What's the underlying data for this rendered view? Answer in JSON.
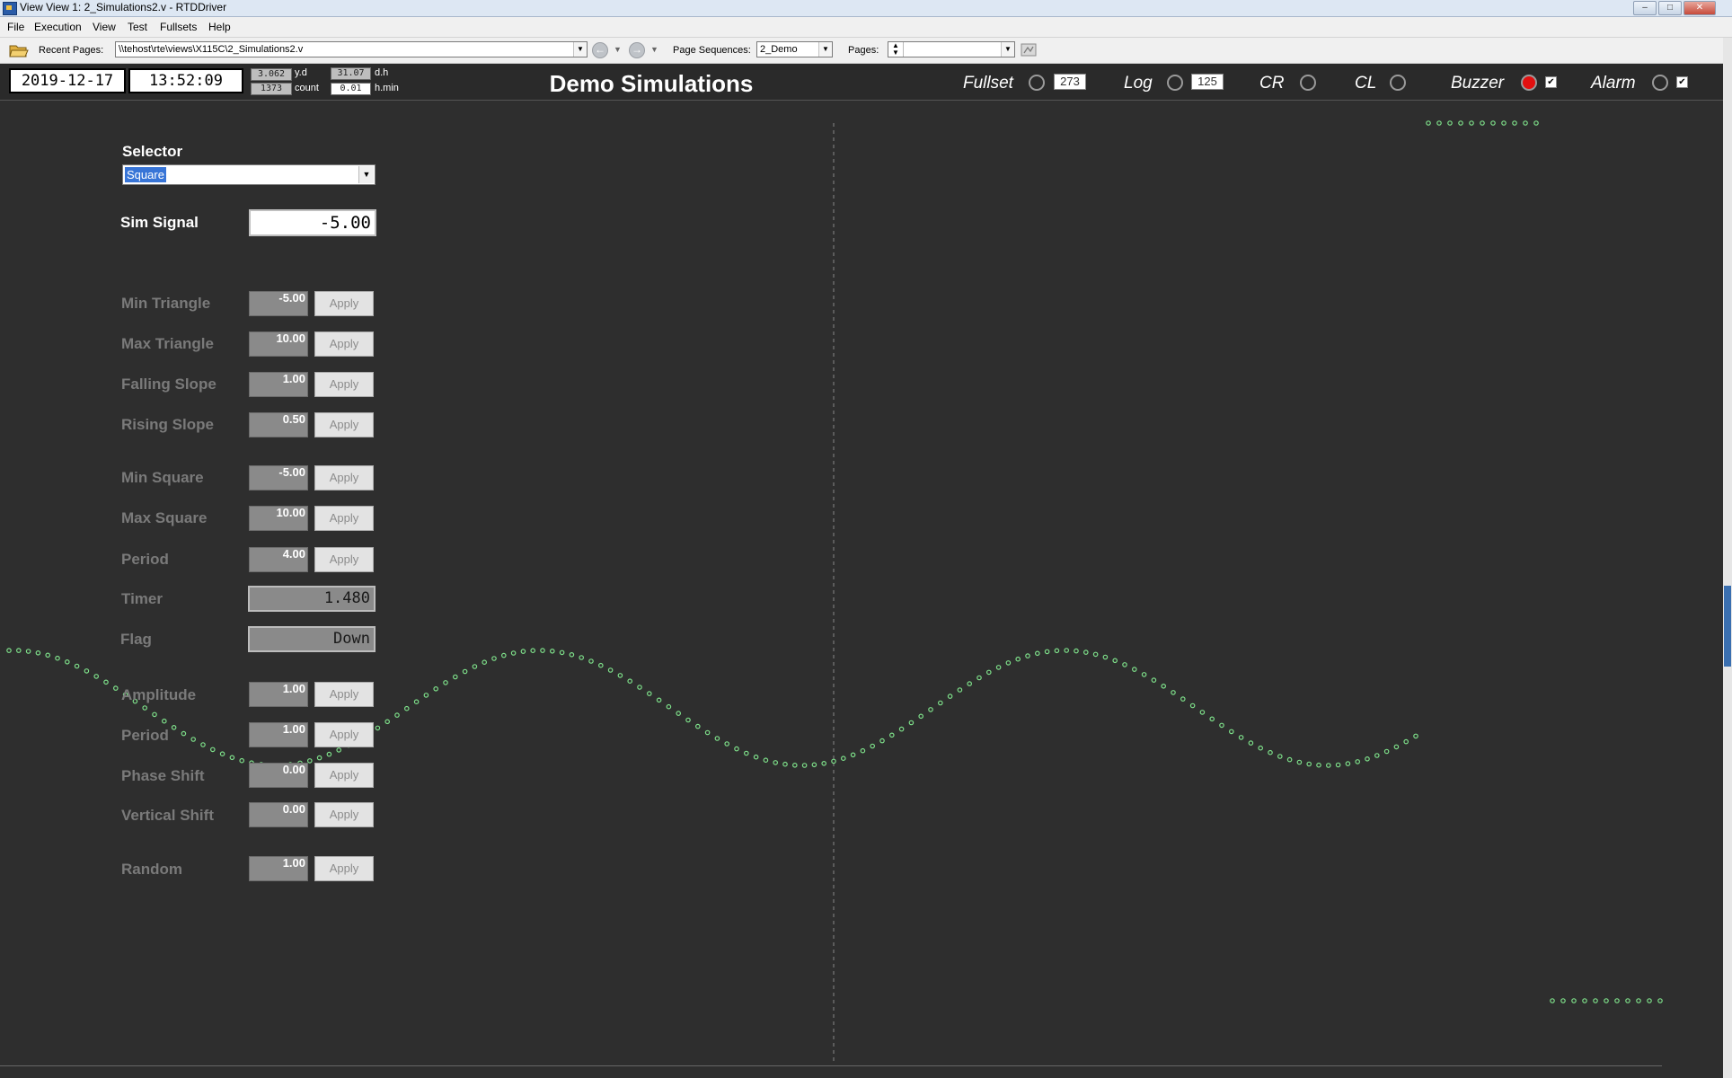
{
  "window": {
    "title": "View View 1: 2_Simulations2.v - RTDDriver"
  },
  "menu": [
    "File",
    "Execution",
    "View",
    "Test",
    "Fullsets",
    "Help"
  ],
  "toolbar": {
    "recent_label": "Recent Pages:",
    "recent_value": "\\\\tehost\\rte\\views\\X115C\\2_Simulations2.v",
    "sequences_label": "Page Sequences:",
    "sequences_value": "2_Demo",
    "pages_label": "Pages:",
    "pages_value": ""
  },
  "header": {
    "date": "2019-12-17",
    "time": "13:52:09",
    "stats": {
      "yd_value": "3.062",
      "yd_label": "y.d",
      "dh_value": "31.07",
      "dh_label": "d.h",
      "count_value": "1373",
      "count_label": "count",
      "hmin_value": "0.01",
      "hmin_label": "h.min"
    },
    "title": "Demo Simulations",
    "indicators": {
      "fullset_label": "Fullset",
      "fullset_count": "273",
      "log_label": "Log",
      "log_count": "125",
      "cr_label": "CR",
      "cl_label": "CL",
      "buzzer_label": "Buzzer",
      "buzzer_checked": "✔",
      "alarm_label": "Alarm",
      "alarm_checked": "✔"
    },
    "colors": {
      "buzzer_led": "#e21010",
      "plot_dots": "#7ee08a"
    }
  },
  "panel": {
    "selector_label": "Selector",
    "selector_value": "Square",
    "sim_signal_label": "Sim Signal",
    "sim_signal_value": "-5.00",
    "apply": "Apply",
    "params": {
      "min_triangle": {
        "label": "Min Triangle",
        "value": "-5.00"
      },
      "max_triangle": {
        "label": "Max Triangle",
        "value": "10.00"
      },
      "falling_slope": {
        "label": "Falling Slope",
        "value": "1.00"
      },
      "rising_slope": {
        "label": "Rising Slope",
        "value": "0.50"
      },
      "min_square": {
        "label": "Min Square",
        "value": "-5.00"
      },
      "max_square": {
        "label": "Max Square",
        "value": "10.00"
      },
      "period_square": {
        "label": "Period",
        "value": "4.00"
      },
      "amplitude": {
        "label": "Amplitude",
        "value": "1.00"
      },
      "period_sine": {
        "label": "Period",
        "value": "1.00"
      },
      "phase_shift": {
        "label": "Phase Shift",
        "value": "0.00"
      },
      "vertical_shift": {
        "label": "Vertical Shift",
        "value": "0.00"
      },
      "random": {
        "label": "Random",
        "value": "1.00"
      }
    },
    "timer": {
      "label": "Timer",
      "value": "1.480"
    },
    "flag": {
      "label": "Flag",
      "value": "Down"
    }
  }
}
